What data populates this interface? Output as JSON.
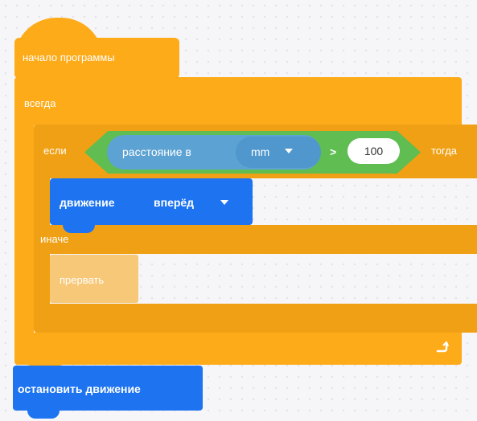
{
  "blocks": {
    "start": {
      "label": "начало программы"
    },
    "forever": {
      "label": "всегда"
    },
    "if_block": {
      "if_label": "если",
      "then_label": "тогда",
      "else_label": "иначе"
    },
    "condition": {
      "sensor_label": "расстояние в",
      "unit_value": "mm",
      "operator": ">",
      "value": "100"
    },
    "move": {
      "label": "движение",
      "direction_value": "вперёд"
    },
    "interrupt": {
      "label": "прервать"
    },
    "stop": {
      "label": "остановить движение"
    }
  },
  "colors": {
    "control": "#fdab19",
    "motion": "#1e74f0",
    "operator": "#5fbd52",
    "sensor": "#5ca2d3"
  },
  "icons": {
    "loop_arrow": "loop-arrow-icon",
    "dropdown": "dropdown-caret-icon"
  }
}
